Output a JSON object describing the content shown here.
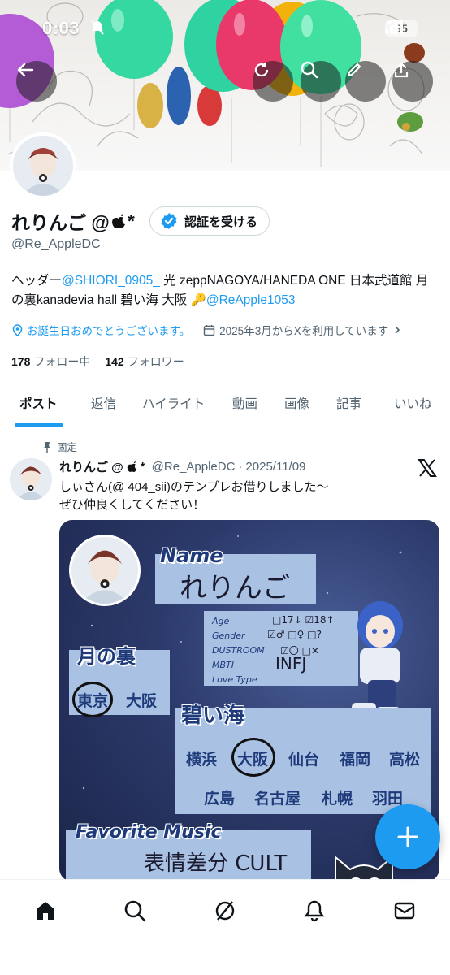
{
  "status_bar": {
    "time": "0:03",
    "battery": "85"
  },
  "profile": {
    "display_name": "れりんご @",
    "name_suffix": "*",
    "verify_label": "認証を受ける",
    "handle": "@Re_AppleDC",
    "bio": {
      "prefix": "ヘッダー",
      "mention1": "@SHIORI_0905_",
      "middle": " 光 zeppNAGOYA/HANEDA ONE 日本武道館 月の裏kanadevia hall 碧い海 大阪 🔑",
      "mention2": "@ReApple1053"
    },
    "birthday_text": "お誕生日おめでとうございます。",
    "joined_text": "2025年3月からXを利用しています",
    "following_count": "178",
    "following_label": "フォロー中",
    "followers_count": "142",
    "followers_label": "フォロワー"
  },
  "tabs": [
    "ポスト",
    "返信",
    "ハイライト",
    "動画",
    "画像",
    "記事",
    "いいね"
  ],
  "active_tab": "ポスト",
  "pinned_post": {
    "pinned_label": "固定",
    "author_name": "れりんご @",
    "author_suffix": "*",
    "author_handle": "@Re_AppleDC",
    "date": "2025/11/09",
    "text_line1": "しぃさん(@ 404_sii)のテンプレお借りしました〜",
    "text_line2": "ぜひ仲良くしてください！"
  },
  "media": {
    "name_label": "Name",
    "name_value": "れりんご",
    "age_label": "Age",
    "age_options": "□17↓ ☑18↑",
    "gender_label": "Gender",
    "gender_options": "☑♂ □♀ □?",
    "dustroom_label": "DUSTROOM",
    "dustroom_options": "☑〇 □✕",
    "mbti_label": "MBTI",
    "mbti_value": "INFJ",
    "lovetype_label": "Love Type",
    "section1_title": "月の裏",
    "section1_cities": [
      "東京",
      "大阪"
    ],
    "section2_title": "碧い海",
    "section2_row1": [
      "横浜",
      "大阪",
      "仙台",
      "福岡",
      "高松"
    ],
    "section2_row2": [
      "広島",
      "名古屋",
      "札幌",
      "羽田"
    ],
    "music_label": "Favorite Music",
    "music_value": "表情差分 CULT"
  },
  "colors": {
    "accent": "#1d9bf0",
    "text": "#0f1419",
    "muted": "#536471"
  }
}
